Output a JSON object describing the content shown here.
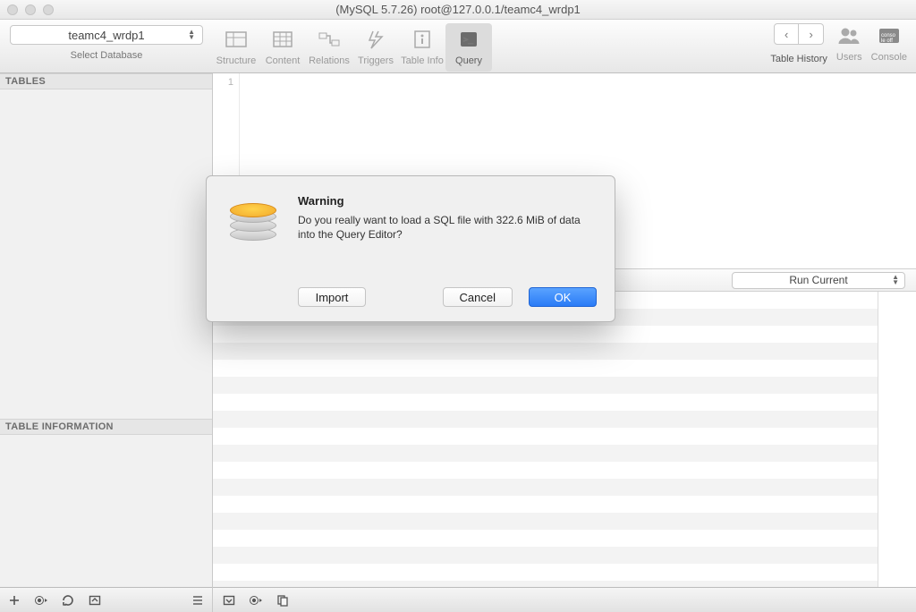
{
  "window": {
    "title": "(MySQL 5.7.26) root@127.0.0.1/teamc4_wrdp1"
  },
  "db_selector": {
    "value": "teamc4_wrdp1",
    "label": "Select Database"
  },
  "toolbar": {
    "structure": "Structure",
    "content": "Content",
    "relations": "Relations",
    "triggers": "Triggers",
    "table_info": "Table Info",
    "query": "Query",
    "table_history": "Table History",
    "users": "Users",
    "console": "Console"
  },
  "sidebar": {
    "tables_header": "TABLES",
    "info_header": "TABLE INFORMATION"
  },
  "editor": {
    "gutter_line": "1"
  },
  "runbar": {
    "selected": "Run Current"
  },
  "dialog": {
    "title": "Warning",
    "message": "Do you really want to load a SQL file with 322.6 MiB of data into the Query Editor?",
    "import": "Import",
    "cancel": "Cancel",
    "ok": "OK"
  }
}
